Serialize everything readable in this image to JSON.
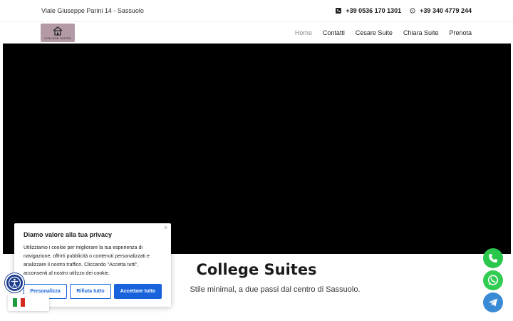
{
  "topbar": {
    "address": "Viale Giuseppe Parini 14 - Sassuolo",
    "phone1": "+39 0536 170 1301",
    "phone2": "+39 340 4779 244",
    "phone1_icon": "phone-icon",
    "phone2_icon": "whatsapp-icon"
  },
  "nav": {
    "logo_text": "COLLEGE SUITES",
    "items": [
      {
        "label": "Home",
        "active": true
      },
      {
        "label": "Contatti"
      },
      {
        "label": "Cesare Suite"
      },
      {
        "label": "Chiara Suite"
      },
      {
        "label": "Prenota"
      }
    ]
  },
  "hero": {
    "title": "College Suites",
    "subtitle": "Stile minimal, a due passi dal centro di Sassuolo."
  },
  "cookie": {
    "title": "Diamo valore alla tua privacy",
    "text": "Utilizziamo i cookie per migliorare la tua esperienza di navigazione, offrirti pubblicità o contenuti personalizzati e analizzare il nostro traffico. Cliccando \"Accetta tutti\", acconsenti al nostro utilizzo dei cookie.",
    "close": "×",
    "btn_customize": "Personalizza",
    "btn_reject": "Rifiuta tutto",
    "btn_accept": "Accettare tutto"
  },
  "floating": {
    "phone_icon": "phone-icon",
    "whatsapp_icon": "whatsapp-icon",
    "telegram_icon": "telegram-icon"
  },
  "colors": {
    "primary_blue": "#1863dc",
    "logo_bg": "#b49aa6",
    "hero_bg": "#000000",
    "whatsapp_green": "#2ac74c",
    "telegram_blue": "#3a8bd6"
  }
}
